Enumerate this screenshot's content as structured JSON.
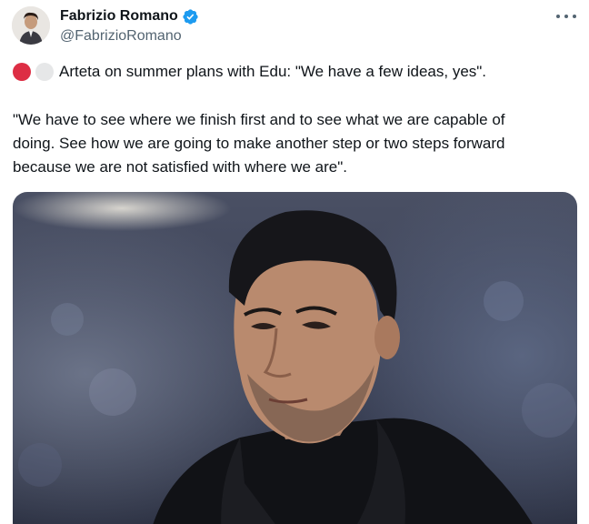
{
  "author": {
    "display_name": "Fabrizio Romano",
    "handle": "@FabrizioRomano",
    "verified": true,
    "avatar_icon": "profile-photo"
  },
  "menu": {
    "icon": "more-horizontal-icon"
  },
  "tweet": {
    "emoji": [
      "red-circle-emoji",
      "white-circle-emoji"
    ],
    "headline": "Arteta on summer plans with Edu: \"We have a few ideas, yes\".",
    "quote_lines": [
      "\"We have to see where we finish first and to see what we are capable of",
      "doing. See how we are going to make another step or two steps forward",
      "because we are not satisfied with where we are\"."
    ]
  },
  "media": {
    "type": "photo"
  },
  "colors": {
    "text": "#0f1419",
    "secondary": "#536471",
    "verified": "#1d9bf0",
    "red_circle": "#dd2e44"
  }
}
